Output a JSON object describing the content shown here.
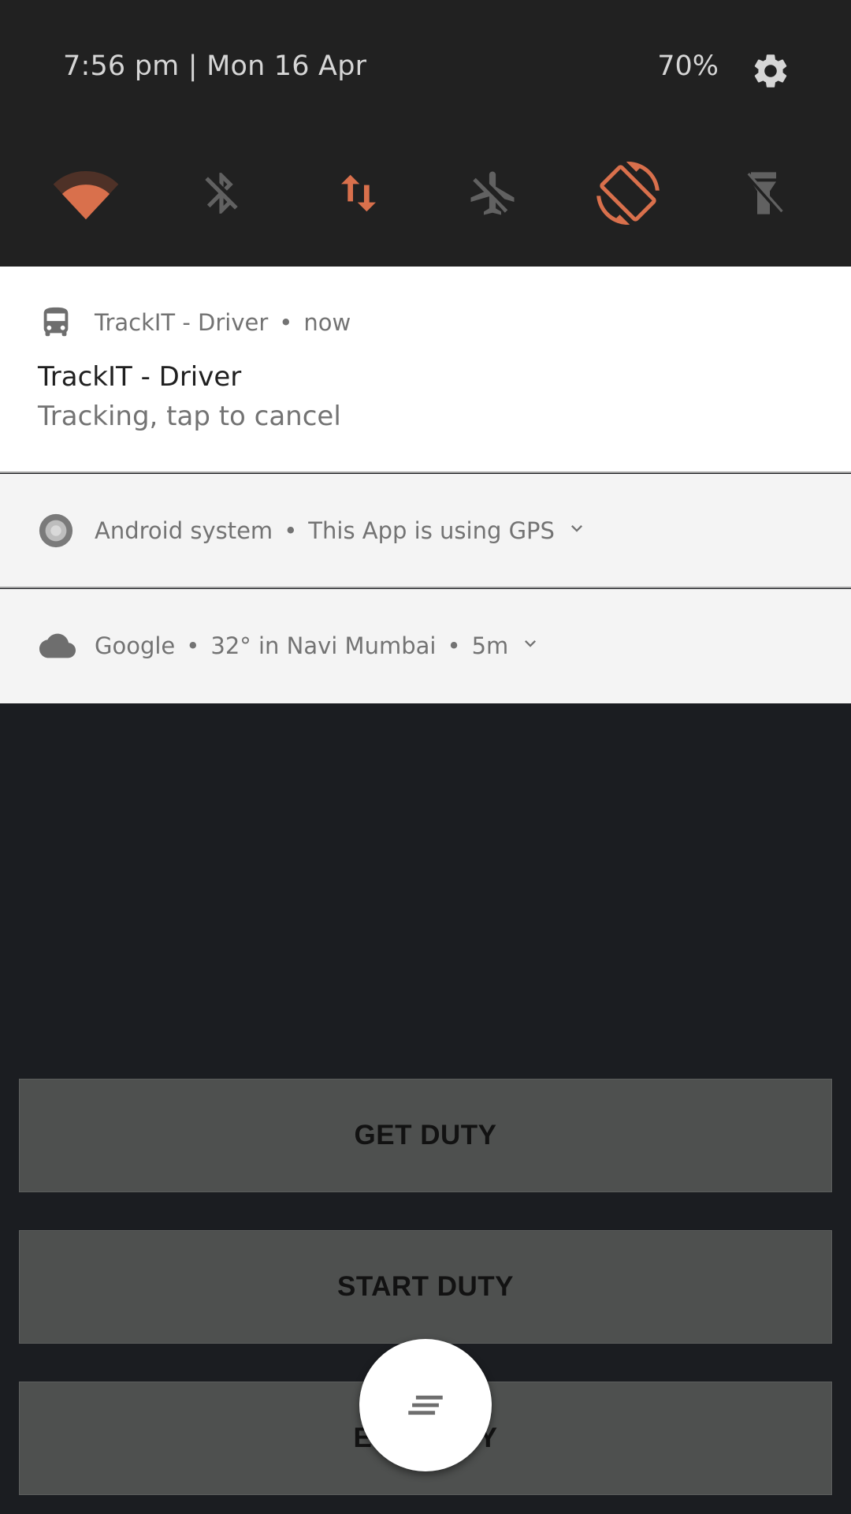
{
  "quick_settings": {
    "time_date": "7:56 pm  |  Mon 16 Apr",
    "battery": "70%",
    "tiles": [
      {
        "name": "wifi-icon",
        "active": true
      },
      {
        "name": "bluetooth-off-icon",
        "active": false
      },
      {
        "name": "mobile-data-icon",
        "active": true
      },
      {
        "name": "airplane-mode-off-icon",
        "active": false
      },
      {
        "name": "auto-rotate-icon",
        "active": true
      },
      {
        "name": "flashlight-off-icon",
        "active": false
      }
    ],
    "colors": {
      "accent": "#d9704c",
      "inactive": "#616161"
    }
  },
  "notifications": [
    {
      "icon": "bus-icon",
      "app": "TrackIT - Driver",
      "time": "now",
      "title": "TrackIT - Driver",
      "text": "Tracking, tap to cancel"
    },
    {
      "icon": "android-system-icon",
      "app": "Android system",
      "summary": "This App is using GPS"
    },
    {
      "icon": "cloud-icon",
      "app": "Google",
      "summary": "32° in Navi Mumbai",
      "time": "5m"
    }
  ],
  "app": {
    "buttons": [
      "GET DUTY",
      "START DUTY",
      "END DUTY"
    ],
    "fab_icon": "clear-all-icon"
  }
}
